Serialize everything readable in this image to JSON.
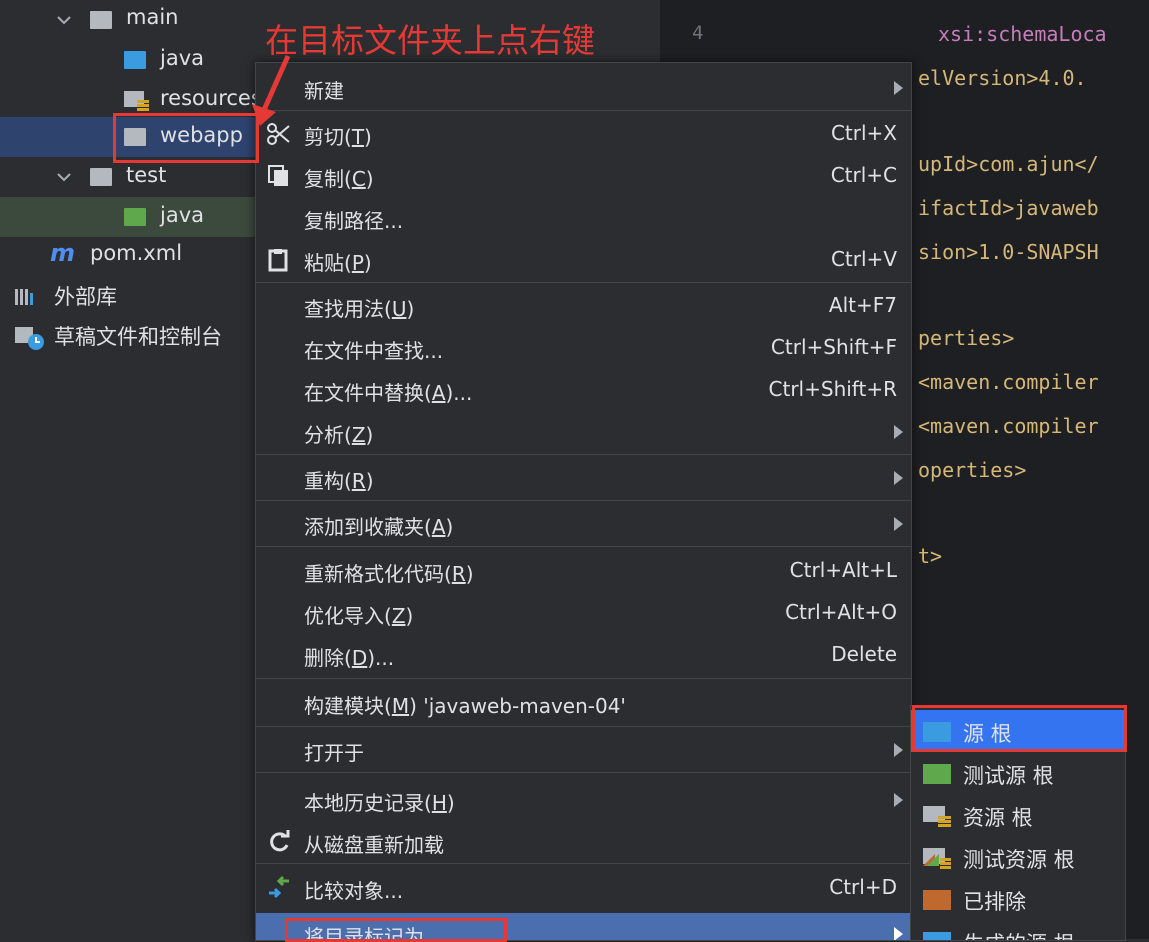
{
  "tree": [
    {
      "label": "main",
      "indent": "main",
      "folder": "grey",
      "expanded": true
    },
    {
      "label": "java",
      "folder": "blue"
    },
    {
      "label": "resources",
      "folder": "resources"
    },
    {
      "label": "webapp",
      "folder": "grey",
      "selected": true
    },
    {
      "label": "test",
      "folder": "grey",
      "expanded": true
    },
    {
      "label": "java",
      "folder": "green"
    },
    {
      "label": "pom.xml",
      "icon": "maven-m-icon"
    },
    {
      "label": "外部库",
      "icon": "library-icon"
    },
    {
      "label": "草稿文件和控制台",
      "icon": "scratch-icon"
    }
  ],
  "gutter": {
    "line_number": "4"
  },
  "editor_lines": [
    "xsi:schemaLoca",
    "elVersion>4.0.",
    "upId>com.ajun</",
    "ifactId>javaweb",
    "sion>1.0-SNAPSH",
    "perties>",
    "<maven.compiler",
    "<maven.compiler",
    "operties>",
    "t>"
  ],
  "annotation": {
    "text": "在目标文件夹上点右键"
  },
  "menu": {
    "new": {
      "label": "新建"
    },
    "cut": {
      "label": "剪切(",
      "mn": "T",
      "tail": ")",
      "shortcut": "Ctrl+X"
    },
    "copy": {
      "label": "复制(",
      "mn": "C",
      "tail": ")",
      "shortcut": "Ctrl+C"
    },
    "copy_path": {
      "label": "复制路径..."
    },
    "paste": {
      "label": "粘贴(",
      "mn": "P",
      "tail": ")",
      "shortcut": "Ctrl+V"
    },
    "find_usages": {
      "label": "查找用法(",
      "mn": "U",
      "tail": ")",
      "shortcut": "Alt+F7"
    },
    "find_in_files": {
      "label": "在文件中查找...",
      "shortcut": "Ctrl+Shift+F"
    },
    "replace_in_files": {
      "label": "在文件中替换(",
      "mn": "A",
      "tail": ")...",
      "shortcut": "Ctrl+Shift+R"
    },
    "analyze": {
      "label": "分析(",
      "mn": "Z",
      "tail": ")"
    },
    "refactor": {
      "label": "重构(",
      "mn": "R",
      "tail": ")"
    },
    "add_to_favorites": {
      "label": "添加到收藏夹(",
      "mn": "A",
      "tail": ")"
    },
    "reformat": {
      "label": "重新格式化代码(",
      "mn": "R",
      "tail": ")",
      "shortcut": "Ctrl+Alt+L"
    },
    "optimize_imports": {
      "label": "优化导入(",
      "mn": "Z",
      "tail": ")",
      "shortcut": "Ctrl+Alt+O"
    },
    "delete": {
      "label": "删除(",
      "mn": "D",
      "tail": ")...",
      "shortcut": "Delete"
    },
    "build_module": {
      "label": "构建模块(",
      "mn": "M",
      "tail": ") 'javaweb-maven-04'"
    },
    "open_in": {
      "label": "打开于"
    },
    "local_history": {
      "label": "本地历史记录(",
      "mn": "H",
      "tail": ")"
    },
    "reload_from_disk": {
      "label": "从磁盘重新加载"
    },
    "compare_with": {
      "label": "比较对象...",
      "shortcut": "Ctrl+D"
    },
    "mark_directory_as": {
      "label": "将目录标记为"
    }
  },
  "submenu": [
    {
      "label": "源 根",
      "color": "#3b9be0"
    },
    {
      "label": "测试源 根",
      "color": "#5fa84c"
    },
    {
      "label": "资源 根",
      "color": "#b4b8bf"
    },
    {
      "label": "测试资源 根",
      "color": "#5fa84c"
    },
    {
      "label": "已排除",
      "color": "#c0692f"
    },
    {
      "label": "生成的源 根",
      "color": "#3b9be0"
    }
  ],
  "colors": {
    "selection": "#2e436e",
    "highlight": "#3574f0",
    "annotation": "#e53935"
  }
}
